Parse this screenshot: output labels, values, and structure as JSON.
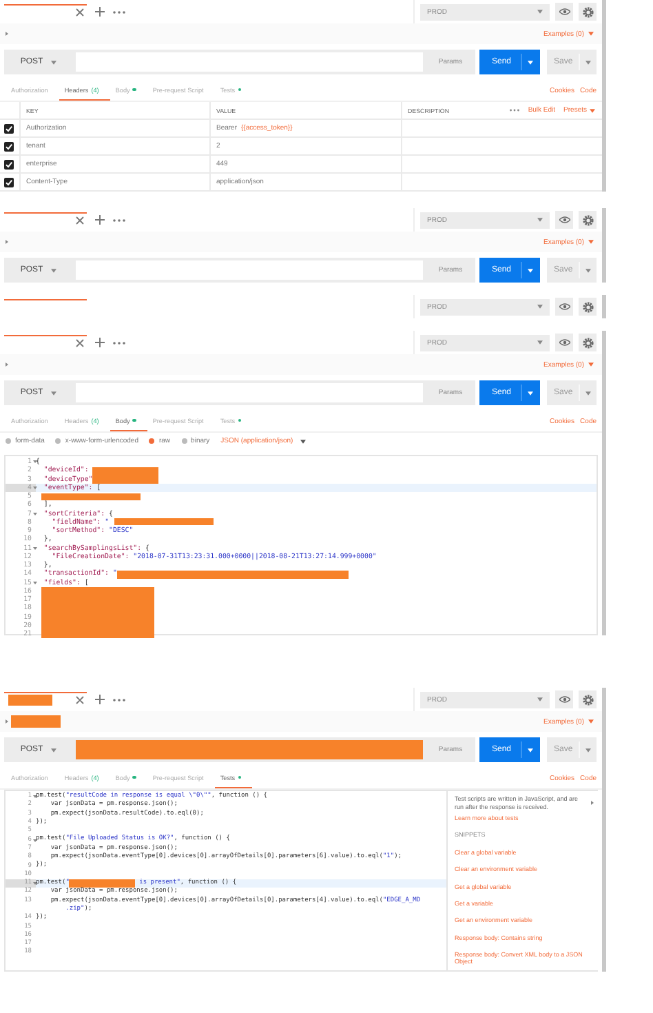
{
  "panels": [
    {
      "tab_bar": {
        "environment": "PROD",
        "actions": true,
        "redacted": false
      },
      "examples": "Examples (0)",
      "name_redacted": false,
      "request": {
        "method": "POST",
        "params": "Params",
        "send": "Send",
        "save": "Save",
        "redacted": false
      },
      "request_tabs": [
        {
          "label": "Authorization",
          "dot": false,
          "selected": false
        },
        {
          "label": "Headers",
          "count": "(4)",
          "dot": false,
          "selected": true
        },
        {
          "label": "Body",
          "dot": true,
          "selected": false
        },
        {
          "label": "Pre-request Script",
          "dot": false,
          "selected": false
        },
        {
          "label": "Tests",
          "dot": true,
          "selected": false
        }
      ],
      "links": [
        "Cookies",
        "Code"
      ],
      "headers": {
        "columns": [
          "KEY",
          "VALUE",
          "DESCRIPTION"
        ],
        "actions": [
          "Bulk Edit",
          "Presets"
        ],
        "rows": [
          {
            "key": "Authorization",
            "value": "Bearer",
            "variable": "{{access_token}}",
            "checked": true
          },
          {
            "key": "tenant",
            "value": "2",
            "checked": true
          },
          {
            "key": "enterprise",
            "value": "449",
            "checked": true
          },
          {
            "key": "Content-Type",
            "value": "application/json",
            "checked": true
          }
        ]
      }
    },
    {
      "tab_bar": {
        "environment": "PROD",
        "actions": true,
        "redacted": false
      },
      "examples": "Examples (0)",
      "name_redacted": false,
      "request": {
        "method": "POST",
        "params": "Params",
        "send": "Send",
        "save": "Save",
        "redacted": false
      }
    },
    {
      "tab_bar": {
        "environment": "PROD",
        "actions": false,
        "redacted": false
      }
    },
    {
      "tab_bar": {
        "environment": "PROD",
        "actions": true,
        "redacted": false
      },
      "examples": "Examples (0)",
      "name_redacted": false,
      "request": {
        "method": "POST",
        "params": "Params",
        "send": "Send",
        "save": "Save",
        "redacted": false
      },
      "request_tabs": [
        {
          "label": "Authorization",
          "dot": false,
          "selected": false
        },
        {
          "label": "Headers",
          "count": "(4)",
          "dot": false,
          "selected": false
        },
        {
          "label": "Body",
          "dot": true,
          "selected": true
        },
        {
          "label": "Pre-request Script",
          "dot": false,
          "selected": false
        },
        {
          "label": "Tests",
          "dot": true,
          "selected": false
        }
      ],
      "links": [
        "Cookies",
        "Code"
      ],
      "body_options": {
        "modes": [
          {
            "label": "form-data",
            "selected": false
          },
          {
            "label": "x-www-form-urlencoded",
            "selected": false
          },
          {
            "label": "raw",
            "selected": true
          },
          {
            "label": "binary",
            "selected": false
          }
        ],
        "format": "JSON (application/json)"
      },
      "editor": {
        "kind": "body",
        "lines": [
          {
            "n": "1",
            "fold": true,
            "active": false,
            "parts": [
              {
                "kind": "plain",
                "text": "{"
              }
            ]
          },
          {
            "n": "2",
            "active": false,
            "parts": [
              {
                "kind": "key",
                "text": "  \"deviceId\": "
              },
              {
                "kind": "mask"
              }
            ]
          },
          {
            "n": "3",
            "active": false,
            "parts": [
              {
                "kind": "key",
                "text": "  \"deviceType\""
              },
              {
                "kind": "mask"
              }
            ]
          },
          {
            "n": "4",
            "fold": true,
            "active": true,
            "parts": [
              {
                "kind": "key",
                "text": "  \"eventType\": "
              },
              {
                "kind": "plain",
                "text": "["
              }
            ]
          },
          {
            "n": "5",
            "active": false,
            "parts": [
              {
                "kind": "widemask"
              }
            ]
          },
          {
            "n": "6",
            "active": false,
            "parts": [
              {
                "kind": "plain",
                "text": "  ],"
              }
            ]
          },
          {
            "n": "7",
            "fold": true,
            "active": false,
            "parts": [
              {
                "kind": "key",
                "text": "  \"sortCriteria\": "
              },
              {
                "kind": "plain",
                "text": "{"
              }
            ]
          },
          {
            "n": "8",
            "active": false,
            "parts": [
              {
                "kind": "key",
                "text": "    \"fieldName\": "
              },
              {
                "kind": "string",
                "text": "\""
              },
              {
                "kind": "widemask"
              }
            ]
          },
          {
            "n": "9",
            "active": false,
            "parts": [
              {
                "kind": "key",
                "text": "    \"sortMethod\": "
              },
              {
                "kind": "string",
                "text": "\"DESC\""
              }
            ]
          },
          {
            "n": "10",
            "active": false,
            "parts": [
              {
                "kind": "plain",
                "text": "  },"
              }
            ]
          },
          {
            "n": "11",
            "fold": true,
            "active": false,
            "parts": [
              {
                "kind": "key",
                "text": "  \"searchBySamplingsList\": "
              },
              {
                "kind": "plain",
                "text": "{"
              }
            ]
          },
          {
            "n": "12",
            "active": false,
            "parts": [
              {
                "kind": "key",
                "text": "    \"FileCreationDate\": "
              },
              {
                "kind": "string",
                "text": "\"2018-07-31T13:23:31.000+0000||2018-08-21T13:27:14.999+0000\""
              }
            ]
          },
          {
            "n": "13",
            "active": false,
            "parts": [
              {
                "kind": "plain",
                "text": "  },"
              }
            ]
          },
          {
            "n": "14",
            "active": false,
            "parts": [
              {
                "kind": "key",
                "text": "  \"transactionId\": "
              },
              {
                "kind": "string",
                "text": "\""
              },
              {
                "kind": "longmask"
              }
            ]
          },
          {
            "n": "15",
            "fold": true,
            "active": false,
            "parts": [
              {
                "kind": "key",
                "text": "  \"fields\": "
              },
              {
                "kind": "plain",
                "text": "["
              }
            ]
          },
          {
            "n": "16",
            "active": false,
            "parts": [
              {
                "kind": "blockmask"
              }
            ]
          },
          {
            "n": "17",
            "active": false
          },
          {
            "n": "18",
            "active": false
          },
          {
            "n": "19",
            "active": false
          },
          {
            "n": "20",
            "active": false
          },
          {
            "n": "21",
            "active": false
          }
        ]
      }
    },
    {
      "tab_bar": {
        "environment": "PROD",
        "actions": true,
        "redacted": true
      },
      "examples": "Examples (0)",
      "name_redacted": true,
      "request": {
        "method": "POST",
        "params": "Params",
        "send": "Send",
        "save": "Save",
        "redacted": true
      },
      "request_tabs": [
        {
          "label": "Authorization",
          "dot": false,
          "selected": false
        },
        {
          "label": "Headers",
          "count": "(4)",
          "dot": false,
          "selected": false
        },
        {
          "label": "Body",
          "dot": true,
          "selected": false
        },
        {
          "label": "Pre-request Script",
          "dot": false,
          "selected": false
        },
        {
          "label": "Tests",
          "dot": true,
          "selected": true
        }
      ],
      "links": [
        "Cookies",
        "Code"
      ],
      "editor": {
        "kind": "tests",
        "lines": [
          {
            "n": "1",
            "fold": true,
            "active": false,
            "parts": [
              {
                "kind": "plain",
                "text": "pm.test("
              },
              {
                "kind": "string",
                "text": "\"resultCode in response is equal \\\"0\\\"\""
              },
              {
                "kind": "plain",
                "text": ", function () {"
              }
            ]
          },
          {
            "n": "2",
            "active": false,
            "parts": [
              {
                "kind": "plain",
                "text": "    var jsonData = pm.response.json();"
              }
            ]
          },
          {
            "n": "3",
            "active": false,
            "parts": [
              {
                "kind": "plain",
                "text": "    pm.expect(jsonData.resultCode).to.eql(0);"
              }
            ]
          },
          {
            "n": "4",
            "active": false,
            "parts": [
              {
                "kind": "plain",
                "text": "});"
              }
            ]
          },
          {
            "n": "5",
            "active": false
          },
          {
            "n": "6",
            "fold": true,
            "active": false,
            "parts": [
              {
                "kind": "plain",
                "text": "pm.test("
              },
              {
                "kind": "string",
                "text": "\"File Uploaded Status is OK?\""
              },
              {
                "kind": "plain",
                "text": ", function () {"
              }
            ]
          },
          {
            "n": "7",
            "active": false,
            "parts": [
              {
                "kind": "plain",
                "text": "    var jsonData = pm.response.json();"
              }
            ]
          },
          {
            "n": "8",
            "active": false,
            "parts": [
              {
                "kind": "plain",
                "text": "    pm.expect(jsonData.eventType[0].devices[0].arrayOfDetails[0].parameters[6].value).to.eql("
              },
              {
                "kind": "string",
                "text": "\"1\""
              },
              {
                "kind": "plain",
                "text": ");"
              }
            ]
          },
          {
            "n": "9",
            "active": false,
            "parts": [
              {
                "kind": "plain",
                "text": "});"
              }
            ]
          },
          {
            "n": "10",
            "active": false
          },
          {
            "n": "11",
            "fold": true,
            "active": true,
            "parts": [
              {
                "kind": "plain",
                "text": "pm.test("
              },
              {
                "kind": "string",
                "text": "\""
              },
              {
                "kind": "mask"
              },
              {
                "kind": "string",
                "text": " is present\""
              },
              {
                "kind": "plain",
                "text": ", function () {"
              }
            ]
          },
          {
            "n": "12",
            "active": false,
            "parts": [
              {
                "kind": "plain",
                "text": "    var jsonData = pm.response.json();"
              }
            ]
          },
          {
            "n": "13",
            "active": false,
            "parts": [
              {
                "kind": "plain",
                "text": "    pm.expect(jsonData.eventType[0].devices[0].arrayOfDetails[0].parameters[4].value).to.eql("
              },
              {
                "kind": "string",
                "text": "\"EDGE_A_MD"
              }
            ],
            "continuation": [
              {
                "kind": "string",
                "text": "        .zip\""
              },
              {
                "kind": "plain",
                "text": ");"
              }
            ]
          },
          {
            "n": "14",
            "active": false,
            "parts": [
              {
                "kind": "plain",
                "text": "});"
              }
            ]
          },
          {
            "n": "15",
            "active": false
          },
          {
            "n": "16",
            "active": false
          },
          {
            "n": "17",
            "active": false
          },
          {
            "n": "18",
            "active": false
          }
        ]
      },
      "snippets": {
        "description": "Test scripts are written in JavaScript, and are run after the response is received.",
        "learn_more": "Learn more about tests",
        "heading": "SNIPPETS",
        "items": [
          "Clear a global variable",
          "Clear an environment variable",
          "Get a global variable",
          "Get a variable",
          "Get an environment variable",
          "Response body: Contains string",
          "Response body: Convert XML body to a JSON Object"
        ]
      }
    }
  ]
}
